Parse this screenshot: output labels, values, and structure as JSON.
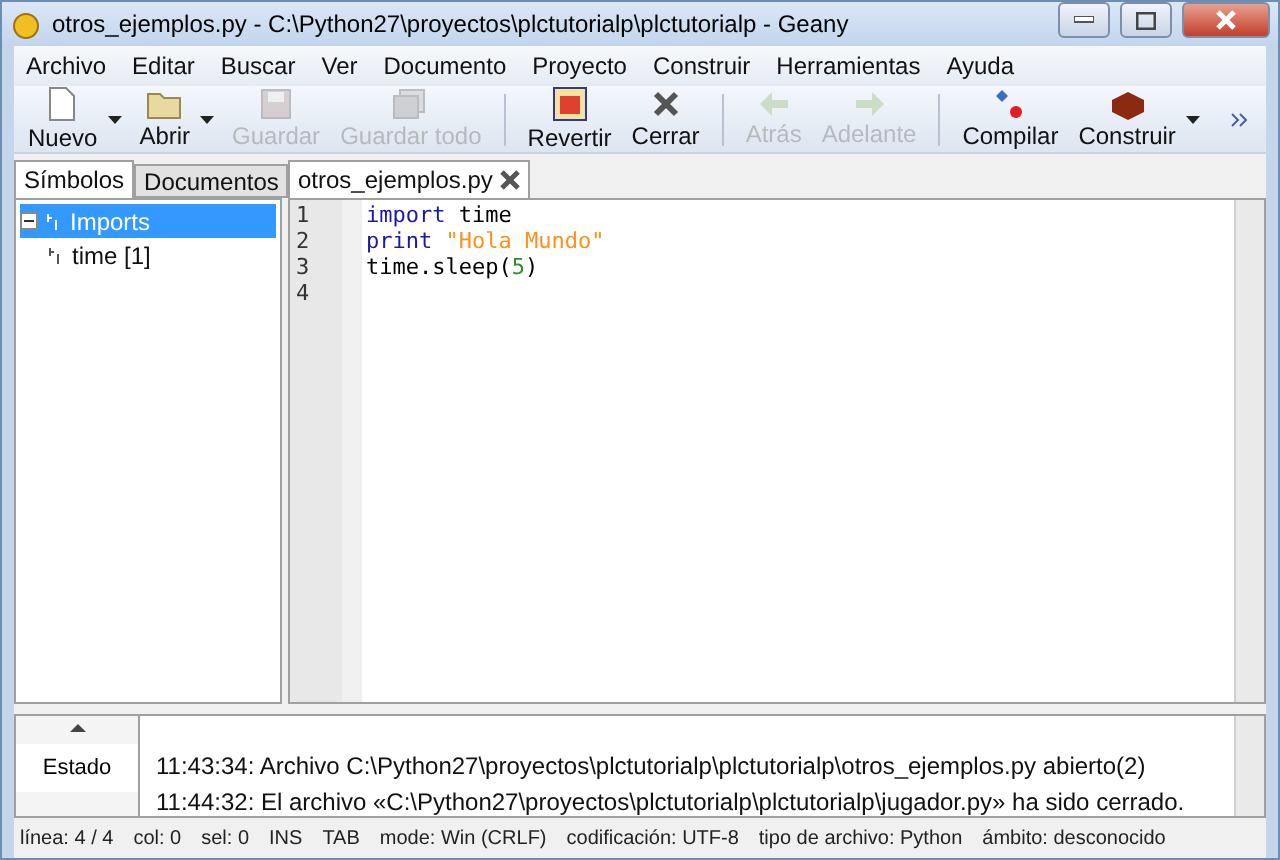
{
  "window": {
    "title": "otros_ejemplos.py - C:\\Python27\\proyectos\\plctutorialp\\plctutorialp - Geany"
  },
  "menu": [
    {
      "label": "Archivo"
    },
    {
      "label": "Editar"
    },
    {
      "label": "Buscar"
    },
    {
      "label": "Ver"
    },
    {
      "label": "Documento"
    },
    {
      "label": "Proyecto"
    },
    {
      "label": "Construir"
    },
    {
      "label": "Herramientas"
    },
    {
      "label": "Ayuda"
    }
  ],
  "toolbar": [
    {
      "kind": "new",
      "label": "Nuevo",
      "disabled": false,
      "dropdown": true
    },
    {
      "kind": "open",
      "label": "Abrir",
      "disabled": false,
      "dropdown": true
    },
    {
      "kind": "save",
      "label": "Guardar",
      "disabled": true,
      "dropdown": false
    },
    {
      "kind": "saveall",
      "label": "Guardar todo",
      "disabled": true,
      "dropdown": false
    },
    {
      "kind": "sep"
    },
    {
      "kind": "revert",
      "label": "Revertir",
      "disabled": false,
      "dropdown": false
    },
    {
      "kind": "close",
      "label": "Cerrar",
      "disabled": false,
      "dropdown": false
    },
    {
      "kind": "sep"
    },
    {
      "kind": "back",
      "label": "Atrás",
      "disabled": true,
      "dropdown": false
    },
    {
      "kind": "forward",
      "label": "Adelante",
      "disabled": true,
      "dropdown": false
    },
    {
      "kind": "sep"
    },
    {
      "kind": "compile",
      "label": "Compilar",
      "disabled": false,
      "dropdown": false
    },
    {
      "kind": "build",
      "label": "Construir",
      "disabled": false,
      "dropdown": true
    }
  ],
  "sidebar": {
    "tabs": [
      {
        "label": "Símbolos",
        "selected": true
      },
      {
        "label": "Documentos",
        "selected": false
      }
    ],
    "tree": [
      {
        "label": "Imports",
        "expanded": true,
        "selected": true,
        "children": [
          {
            "label": "time [1]",
            "selected": false
          }
        ]
      }
    ]
  },
  "editor": {
    "tabs": [
      {
        "label": "otros_ejemplos.py",
        "selected": true
      }
    ],
    "lines": [
      {
        "number": "1",
        "tokens": [
          {
            "text": "import",
            "kind": "keyword"
          },
          {
            "text": " time",
            "kind": "plain"
          }
        ]
      },
      {
        "number": "2",
        "tokens": [
          {
            "text": "print",
            "kind": "keyword"
          },
          {
            "text": " \"Hola Mundo\"",
            "kind": "string"
          }
        ]
      },
      {
        "number": "3",
        "tokens": [
          {
            "text": "time.sleep(",
            "kind": "plain"
          },
          {
            "text": "5",
            "kind": "number"
          },
          {
            "text": ")",
            "kind": "plain"
          }
        ]
      },
      {
        "number": "4"
      }
    ]
  },
  "messages": {
    "tabs": [
      {
        "label": "Estado",
        "selected": true
      }
    ],
    "lines": [
      "11:43:34: Archivo C:\\Python27\\proyectos\\plctutorialp\\plctutorialp\\otros_ejemplos.py abierto(2)",
      "11:44:32: El archivo «C:\\Python27\\proyectos\\plctutorialp\\plctutorialp\\jugador.py» ha sido cerrado."
    ]
  },
  "status_bar": [
    "línea: 4 / 4",
    "col: 0",
    "sel: 0",
    "INS",
    "TAB",
    "mode: Win (CRLF)",
    "codificación: UTF-8",
    "tipo de archivo: Python",
    "ámbito: desconocido"
  ]
}
